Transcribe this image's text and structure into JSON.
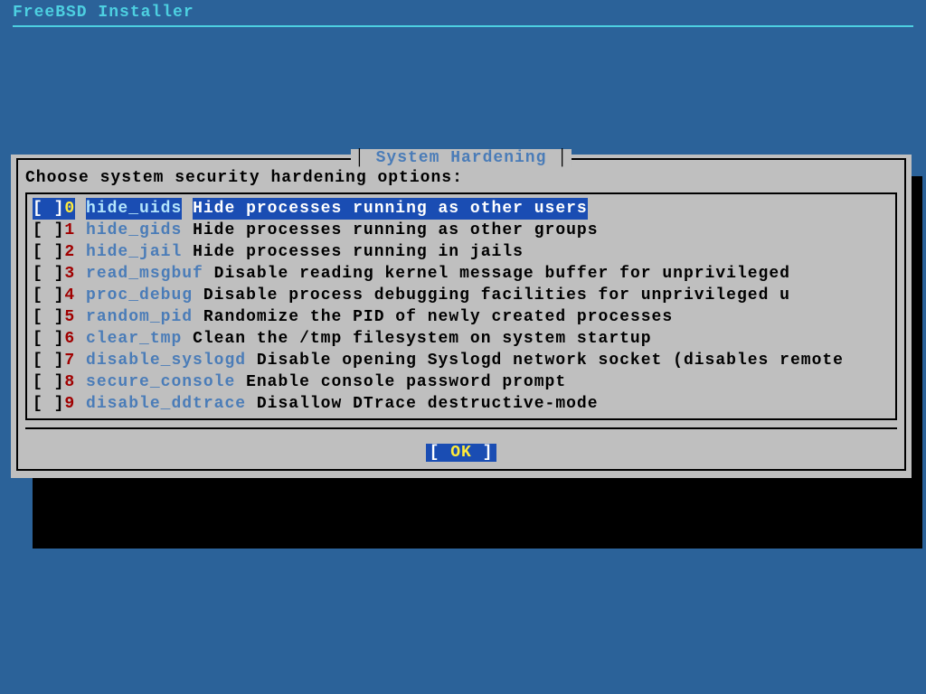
{
  "header": {
    "title": "FreeBSD Installer"
  },
  "dialog": {
    "title": "System Hardening",
    "prompt": "Choose system security hardening options:",
    "ok_label": "OK",
    "name_width": 15,
    "items": [
      {
        "index": "0",
        "name": "hide_uids",
        "desc": "Hide processes running as other users",
        "selected": true
      },
      {
        "index": "1",
        "name": "hide_gids",
        "desc": "Hide processes running as other groups",
        "selected": false
      },
      {
        "index": "2",
        "name": "hide_jail",
        "desc": "Hide processes running in jails",
        "selected": false
      },
      {
        "index": "3",
        "name": "read_msgbuf",
        "desc": "Disable reading kernel message buffer for unprivileged",
        "selected": false
      },
      {
        "index": "4",
        "name": "proc_debug",
        "desc": "Disable process debugging facilities for unprivileged u",
        "selected": false
      },
      {
        "index": "5",
        "name": "random_pid",
        "desc": "Randomize the PID of newly created processes",
        "selected": false
      },
      {
        "index": "6",
        "name": "clear_tmp",
        "desc": "Clean the /tmp filesystem on system startup",
        "selected": false
      },
      {
        "index": "7",
        "name": "disable_syslogd",
        "desc": "Disable opening Syslogd network socket (disables remote",
        "selected": false
      },
      {
        "index": "8",
        "name": "secure_console",
        "desc": "Enable console password prompt",
        "selected": false
      },
      {
        "index": "9",
        "name": "disable_ddtrace",
        "desc": "Disallow DTrace destructive-mode",
        "selected": false
      }
    ]
  }
}
